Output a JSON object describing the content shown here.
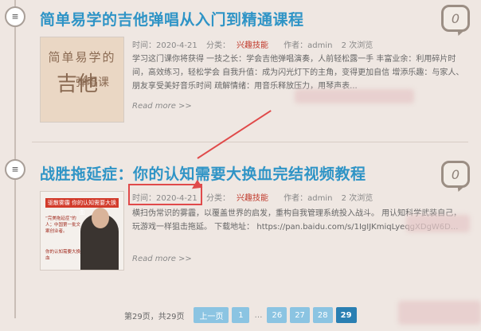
{
  "posts": [
    {
      "title": "简单易学的吉他弹唱从入门到精通课程",
      "comments": "0",
      "meta": {
        "date": "时间：2020-4-21",
        "category_prefix": "分类：",
        "category": "兴趣技能",
        "author": "作者：admin",
        "views": "2 次浏览"
      },
      "thumbnail_text": [
        "简单易学的",
        "吉他",
        "弹唱课"
      ],
      "excerpt": "学习这门课你将获得 一技之长：学会吉他弹唱演奏，人前轻松露一手 丰富业余：利用碎片时间，高效练习，轻松学会 自我升值：成为闪光灯下的主角，变得更加自信 增添乐趣：与家人、朋友享受美好音乐时间 疏解情绪：用音乐释放压力，用琴声表...",
      "read_more": "Read more >>"
    },
    {
      "title": "战胜拖延症：你的认知需要大换血完结视频教程",
      "comments": "0",
      "meta": {
        "date": "时间：2020-4-21",
        "category_prefix": "分类：",
        "category": "兴趣技能",
        "author": "作者：admin",
        "views": "2 次浏览"
      },
      "thumbnail_text": [
        "驱散雾霾 你的认知需要大换血",
        "“完美拖延症”的人；中国第一批文案创业者。",
        "你的认知需要大换血"
      ],
      "excerpt": "横扫伪常识的雾霾，以覆盖世界的启发，重构自我管理系统投入战斗。 用认知科学武装自己，玩游戏一样狙击拖延。 下载地址： https://pan.baidu.com/s/1IgIJKmiqLyeqgXDgW6D...",
      "read_more": "Read more >>"
    }
  ],
  "pagination": {
    "info": "第29页，共29页",
    "prev": "上一页",
    "first": "1",
    "ellipsis": "…",
    "pages": [
      "26",
      "27",
      "28",
      "29"
    ],
    "current": "29"
  },
  "colors": {
    "background": "#efe7e2",
    "title": "#2f94c6",
    "category": "#c0392b",
    "highlight": "#e04a4a",
    "page_button": "#8bc4e2",
    "page_current": "#2a7fb2"
  }
}
